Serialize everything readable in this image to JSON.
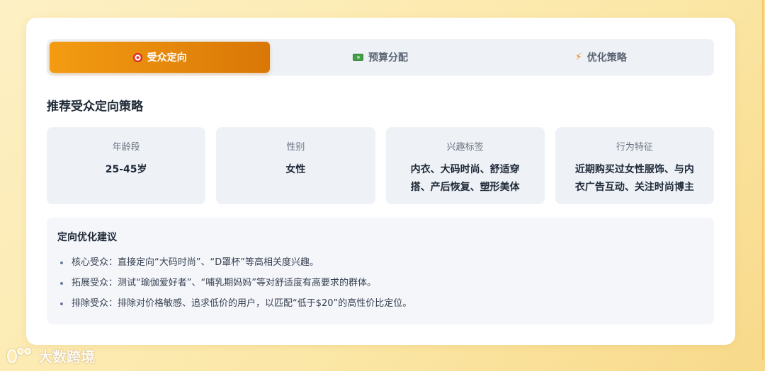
{
  "tabs": [
    {
      "label": "受众定向",
      "icon": "target-icon",
      "active": true
    },
    {
      "label": "预算分配",
      "icon": "money-icon",
      "active": false
    },
    {
      "label": "优化策略",
      "icon": "lightning-icon",
      "active": false
    }
  ],
  "section_title": "推荐受众定向策略",
  "stats": [
    {
      "label": "年龄段",
      "value": "25-45岁"
    },
    {
      "label": "性别",
      "value": "女性"
    },
    {
      "label": "兴趣标签",
      "value": "内衣、大码时尚、舒适穿搭、产后恢复、塑形美体"
    },
    {
      "label": "行为特征",
      "value": "近期购买过女性服饰、与内衣广告互动、关注时尚博主"
    }
  ],
  "advice": {
    "title": "定向优化建议",
    "items": [
      "核心受众：直接定向“大码时尚”、“D罩杯”等高相关度兴趣。",
      "拓展受众：测试“瑜伽爱好者”、“哺乳期妈妈”等对舒适度有高要求的群体。",
      "排除受众：排除对价格敏感、追求低价的用户，以匹配“低于$20”的高性价比定位。"
    ]
  },
  "watermark": "大数跨境",
  "colors": {
    "accent": "#f39c12",
    "accent_dark": "#d97706",
    "background": "#fbe7a6"
  }
}
